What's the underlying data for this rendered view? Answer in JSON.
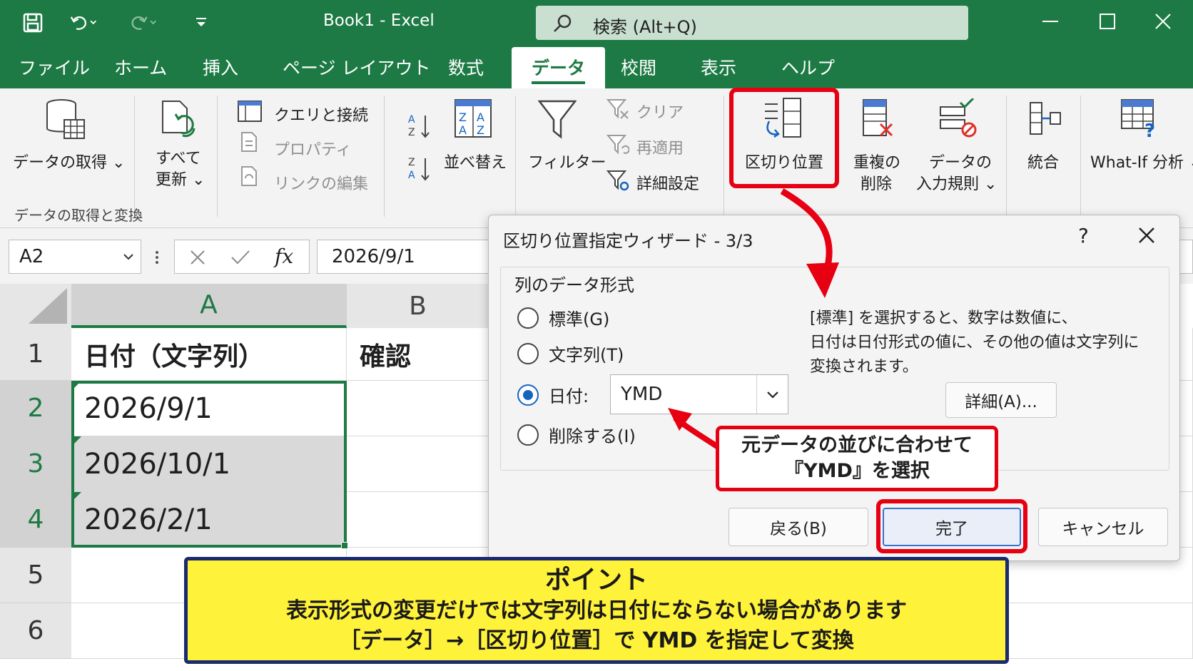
{
  "titlebar": {
    "title": "Book1  -  Excel",
    "search_placeholder": "検索 (Alt+Q)",
    "bg_color": "#1d7a44"
  },
  "tabs": [
    {
      "label": "ファイル"
    },
    {
      "label": "ホーム"
    },
    {
      "label": "挿入"
    },
    {
      "label": "ページ レイアウト"
    },
    {
      "label": "数式"
    },
    {
      "label": "データ",
      "active": true
    },
    {
      "label": "校閲"
    },
    {
      "label": "表示"
    },
    {
      "label": "ヘルプ"
    }
  ],
  "ribbon": {
    "get_data": "データの取得 ⌄",
    "refresh_all_line1": "すべて",
    "refresh_all_line2": "更新 ⌄",
    "queries": "クエリと接続",
    "properties": "プロパティ",
    "edit_links": "リンクの編集",
    "group_get_transform": "データの取得と変換",
    "sort": "並べ替え",
    "filter": "フィルター",
    "clear": "クリア",
    "reapply": "再適用",
    "advanced": "詳細設定",
    "text_to_columns": "区切り位置",
    "remove_dup_line1": "重複の",
    "remove_dup_line2": "削除",
    "validation_line1": "データの",
    "validation_line2": "入力規則 ⌄",
    "consolidate": "統合",
    "whatif": "What-If 分析 ⌄"
  },
  "formula_bar": {
    "name_box": "A2",
    "fx": "fx",
    "value": "2026/9/1"
  },
  "grid": {
    "columns": [
      "A",
      "B"
    ],
    "rows": [
      "1",
      "2",
      "3",
      "4",
      "5",
      "6"
    ],
    "cells": {
      "a1": "日付（文字列）",
      "b1": "確認",
      "a2": "2026/9/1",
      "a3": "2026/10/1",
      "a4": "2026/2/1"
    }
  },
  "dialog": {
    "title": "区切り位置指定ウィザード - 3/3",
    "help": "?",
    "section_label": "列のデータ形式",
    "options": [
      {
        "label": "標準(G)",
        "selected": false
      },
      {
        "label": "文字列(T)",
        "selected": false
      },
      {
        "label": "日付:",
        "selected": true
      },
      {
        "label": "削除する(I)",
        "selected": false
      }
    ],
    "date_format": "YMD",
    "description": [
      "[標準] を選択すると、数字は数値に、",
      "日付は日付形式の値に、その他の値は文字列に",
      "変換されます。"
    ],
    "details_button": "詳細(A)...",
    "back_button": "戻る(B)",
    "finish_button": "完了",
    "cancel_button": "キャンセル"
  },
  "callout": {
    "line1": "元データの並びに合わせて",
    "line2": "『YMD』を選択"
  },
  "point_box": {
    "title": "ポイント",
    "line1": "表示形式の変更だけでは文字列は日付にならない場合があります",
    "line2": "［データ］→［区切り位置］で YMD を指定して変換"
  },
  "colors": {
    "excel_green": "#1d7a44",
    "highlight_red": "#e60012",
    "note_yellow": "#fff23a",
    "note_border": "#1a2a6c",
    "radio_blue": "#1565c0"
  }
}
